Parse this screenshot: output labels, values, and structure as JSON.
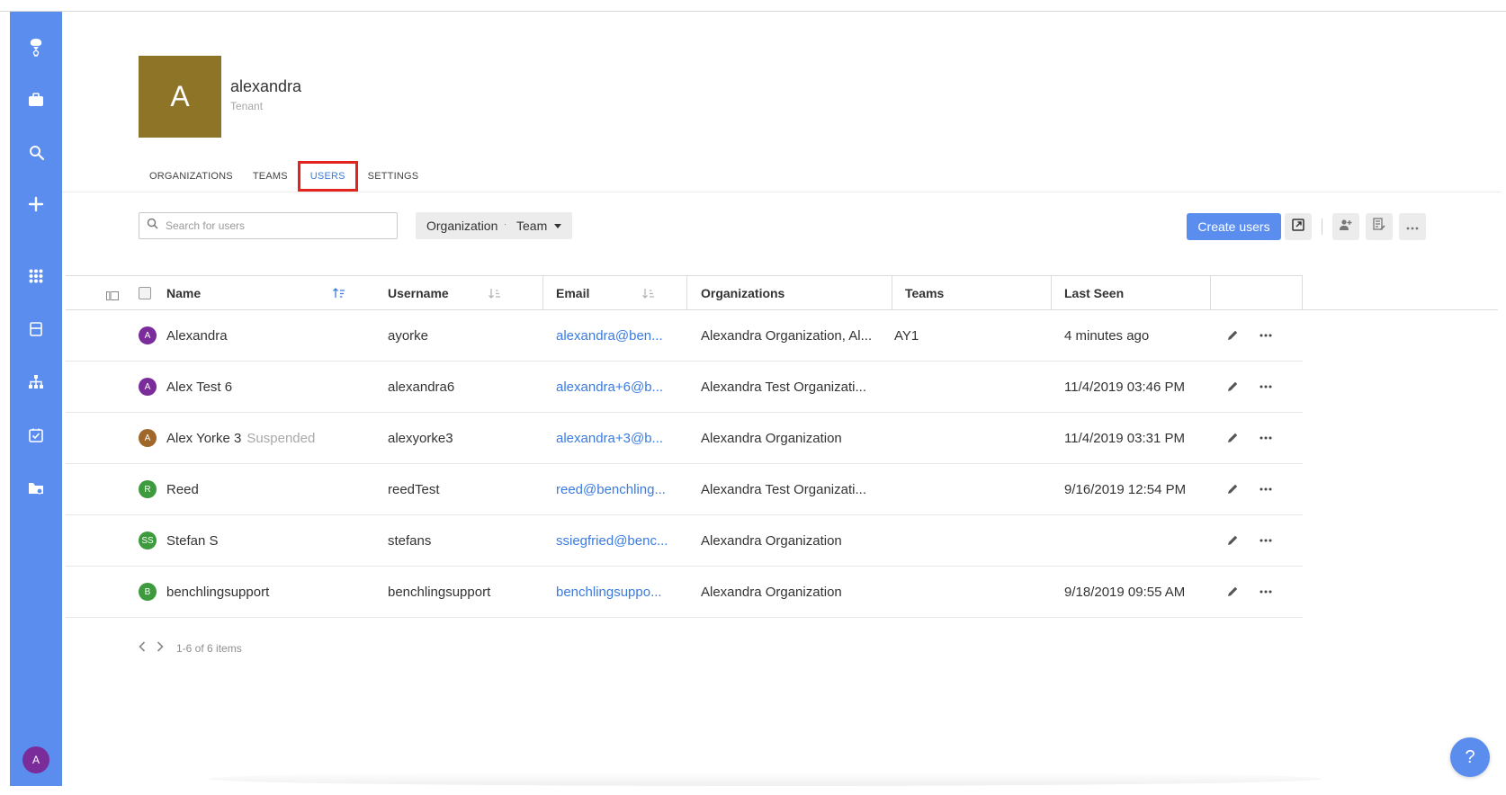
{
  "colors": {
    "sidebar": "#5b8def",
    "accent": "#3b7be0",
    "highlight_box": "#e2241c",
    "tenant_avatar": "#8d7427"
  },
  "sidebar": {
    "icons": [
      "benchling-logo-icon",
      "briefcase-icon",
      "search-icon",
      "plus-icon",
      "apps-grid-icon",
      "notebook-icon",
      "hierarchy-icon",
      "checkbox-task-icon",
      "folder-settings-icon"
    ],
    "user_initial": "A"
  },
  "header": {
    "initial": "A",
    "name": "alexandra",
    "subtitle": "Tenant"
  },
  "tabs": [
    {
      "label": "ORGANIZATIONS",
      "active": false
    },
    {
      "label": "TEAMS",
      "active": false
    },
    {
      "label": "USERS",
      "active": true
    },
    {
      "label": "SETTINGS",
      "active": false
    }
  ],
  "toolbar": {
    "search_placeholder": "Search for users",
    "organization_filter": "Organization",
    "team_filter": "Team",
    "create_label": "Create users",
    "icon_buttons": [
      "export-icon",
      "add-users-icon",
      "bulk-edit-icon",
      "more-icon"
    ]
  },
  "table": {
    "columns": [
      "Name",
      "Username",
      "Email",
      "Organizations",
      "Teams",
      "Last Seen"
    ],
    "rows": [
      {
        "initial": "A",
        "avatar_color": "#7b2c9b",
        "name": "Alexandra",
        "status": "",
        "username": "ayorke",
        "email": "alexandra@ben...",
        "organizations": "Alexandra Organization, Al...",
        "teams": "AY1",
        "last_seen": "4 minutes ago"
      },
      {
        "initial": "A",
        "avatar_color": "#7b2c9b",
        "name": "Alex Test 6",
        "status": "",
        "username": "alexandra6",
        "email": "alexandra+6@b...",
        "organizations": "Alexandra Test Organizati...",
        "teams": "",
        "last_seen": "11/4/2019 03:46 PM"
      },
      {
        "initial": "A",
        "avatar_color": "#a0672a",
        "name": "Alex Yorke 3",
        "status": "Suspended",
        "username": "alexyorke3",
        "email": "alexandra+3@b...",
        "organizations": "Alexandra Organization",
        "teams": "",
        "last_seen": "11/4/2019 03:31 PM"
      },
      {
        "initial": "R",
        "avatar_color": "#3d9a3d",
        "name": "Reed",
        "status": "",
        "username": "reedTest",
        "email": "reed@benchling...",
        "organizations": "Alexandra Test Organizati...",
        "teams": "",
        "last_seen": "9/16/2019 12:54 PM"
      },
      {
        "initial": "SS",
        "avatar_color": "#3d9a3d",
        "name": "Stefan S",
        "status": "",
        "username": "stefans",
        "email": "ssiegfried@benc...",
        "organizations": "Alexandra Organization",
        "teams": "",
        "last_seen": ""
      },
      {
        "initial": "B",
        "avatar_color": "#3d9a3d",
        "name": "benchlingsupport",
        "status": "",
        "username": "benchlingsupport",
        "email": "benchlingsuppo...",
        "organizations": "Alexandra Organization",
        "teams": "",
        "last_seen": "9/18/2019 09:55 AM"
      }
    ]
  },
  "pagination": {
    "text": "1-6 of 6 items"
  },
  "help": {
    "label": "?"
  }
}
